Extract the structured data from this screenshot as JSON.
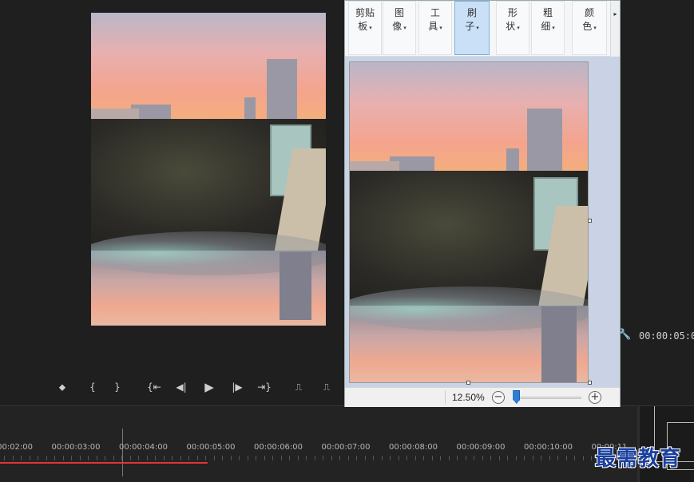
{
  "paint": {
    "ribbon": {
      "groups": [
        {
          "line1": "剪贴",
          "line2": "板"
        },
        {
          "line1": "图",
          "line2": "像"
        },
        {
          "line1": "工",
          "line2": "具"
        },
        {
          "line1": "刷",
          "line2": "子"
        },
        {
          "line1": "形",
          "line2": "状"
        },
        {
          "line1": "粗",
          "line2": "细"
        },
        {
          "line1": "颜",
          "line2": "色"
        }
      ],
      "scroll_arrow": "▸",
      "dropdown_arrow": "▾"
    },
    "status": {
      "zoom": "12.50%",
      "zoom_out": "−",
      "zoom_in": "+",
      "zoom_level": 0.05
    }
  },
  "editor": {
    "timecode": "00:00:05:0",
    "wrench_icon": "🔧",
    "transport": {
      "marker_icon": "⬥",
      "mark_in": "{",
      "mark_out": "}",
      "go_to_in": "{⇤",
      "step_back": "◀|",
      "play": "▶",
      "step_forward": "|▶",
      "go_to_out": "⇥}",
      "insert_icon": "⎍",
      "overwrite_icon": "⎍"
    },
    "timeline": {
      "labels": [
        "00:00:02:00",
        "00:00:03:00",
        "00:00:04:00",
        "00:00:05:00",
        "00:00:06:00",
        "00:00:07:00",
        "00:00:08:00",
        "00:00:09:00",
        "00:00:10:00",
        "00:00:11"
      ]
    }
  },
  "watermark": "最需教育",
  "colors": {
    "accent": "#2a7fd6",
    "playhead_red": "#e03535",
    "watermark": "#1a3f9c"
  }
}
